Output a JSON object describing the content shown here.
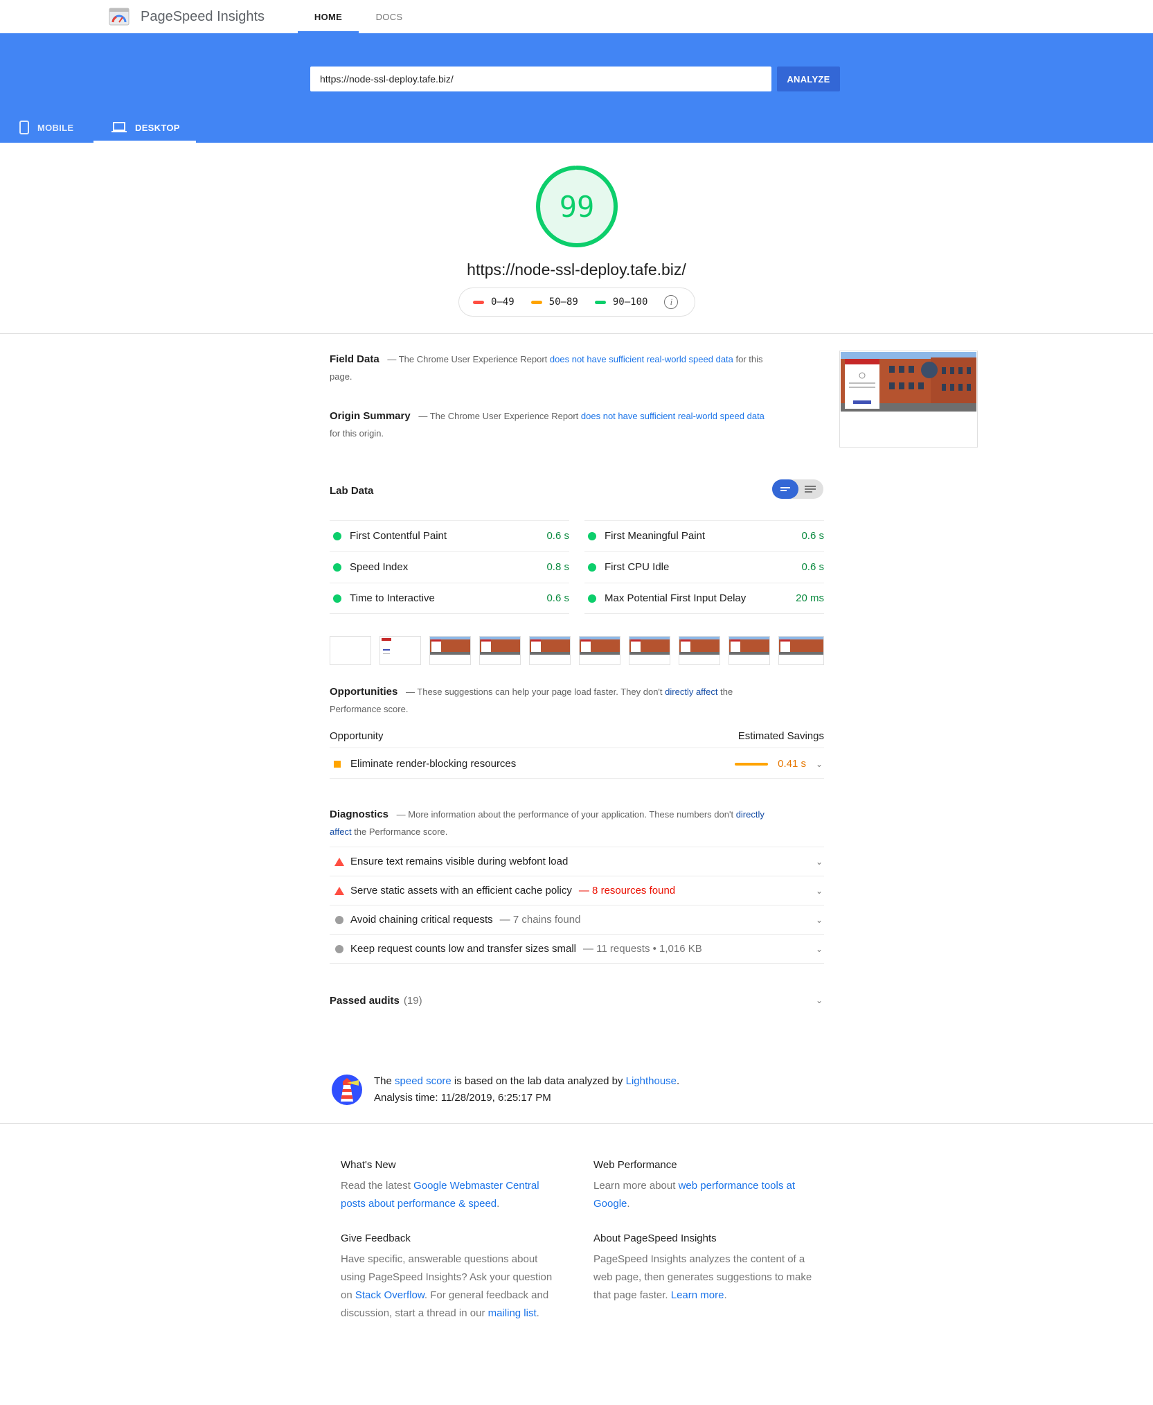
{
  "header": {
    "brand": "PageSpeed Insights",
    "nav": [
      "HOME",
      "DOCS"
    ]
  },
  "search": {
    "url": "https://node-ssl-deploy.tafe.biz/",
    "analyze_label": "ANALYZE"
  },
  "devices": {
    "mobile": "MOBILE",
    "desktop": "DESKTOP",
    "selected": "DESKTOP"
  },
  "score": {
    "value": "99",
    "fraction": 0.99,
    "url": "https://node-ssl-deploy.tafe.biz/",
    "legend": [
      "0–49",
      "50–89",
      "90–100"
    ],
    "colors": {
      "fail": "#ff4e42",
      "average": "#ffa400",
      "pass": "#0cce6b"
    }
  },
  "field": {
    "title": "Field Data",
    "pre": "— The Chrome User Experience Report",
    "link": "does not have sufficient real-world speed data",
    "post": "for this page."
  },
  "origin": {
    "title": "Origin Summary",
    "pre": "— The Chrome User Experience Report",
    "link": "does not have sufficient real-world speed data",
    "post": "for this origin."
  },
  "lab": {
    "title": "Lab Data",
    "metrics": [
      {
        "label": "First Contentful Paint",
        "value": "0.6 s"
      },
      {
        "label": "First Meaningful Paint",
        "value": "0.6 s"
      },
      {
        "label": "Speed Index",
        "value": "0.8 s"
      },
      {
        "label": "First CPU Idle",
        "value": "0.6 s"
      },
      {
        "label": "Time to Interactive",
        "value": "0.6 s"
      },
      {
        "label": "Max Potential First Input Delay",
        "value": "20 ms"
      }
    ]
  },
  "opportunities": {
    "title": "Opportunities",
    "pre": "— These suggestions can help your page load faster. They don't",
    "link": "directly affect",
    "post": "the Performance score.",
    "col_left": "Opportunity",
    "col_right": "Estimated Savings",
    "items": [
      {
        "label": "Eliminate render-blocking resources",
        "value": "0.41 s"
      }
    ]
  },
  "diagnostics": {
    "title": "Diagnostics",
    "pre": "— More information about the performance of your application. These numbers don't",
    "link": "directly affect",
    "post": "the Performance score.",
    "items": [
      {
        "label": "Ensure text remains visible during webfont load",
        "extra": ""
      },
      {
        "label": "Serve static assets with an efficient cache policy",
        "extra": "— 8 resources found"
      },
      {
        "label": "Avoid chaining critical requests",
        "extra": "— 7 chains found"
      },
      {
        "label": "Keep request counts low and transfer sizes small",
        "extra": "— 11 requests • 1,016 KB"
      }
    ]
  },
  "passed": {
    "title": "Passed audits",
    "count": "(19)"
  },
  "footer_note": {
    "pre": "The",
    "link1": "speed score",
    "mid": "is based on the lab data analyzed by",
    "link2": "Lighthouse",
    "end": ".",
    "analysis": "Analysis time: 11/28/2019, 6:25:17 PM"
  },
  "footer": {
    "whats_new": {
      "title": "What's New",
      "pre": "Read the latest",
      "link": "Google Webmaster Central posts about performance & speed",
      "post": "."
    },
    "web_perf": {
      "title": "Web Performance",
      "pre": "Learn more about",
      "link": "web performance tools at Google",
      "post": "."
    },
    "feedback": {
      "title": "Give Feedback",
      "pre": "Have specific, answerable questions about using PageSpeed Insights? Ask your question on",
      "link1": "Stack Overflow",
      "mid": ". For general feedback and discussion, start a thread in our",
      "link2": "mailing list",
      "post": "."
    },
    "about": {
      "title": "About PageSpeed Insights",
      "pre": "PageSpeed Insights analyzes the content of a web page, then generates suggestions to make that page faster.",
      "link": "Learn more",
      "post": "."
    }
  }
}
